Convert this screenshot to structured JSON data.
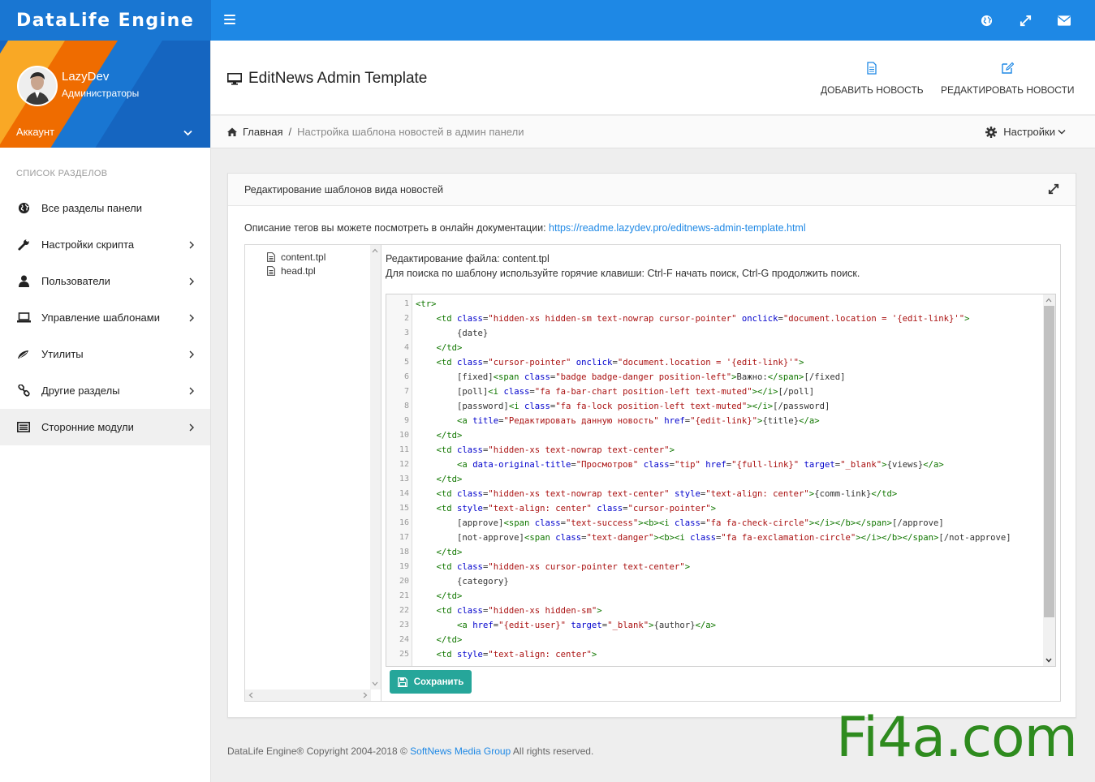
{
  "app": {
    "brand": "DataLife Engine"
  },
  "user": {
    "name": "LazyDev",
    "role": "Администраторы",
    "account_label": "Аккаунт"
  },
  "sidebar": {
    "section_title": "СПИСОК РАЗДЕЛОВ",
    "items": [
      {
        "label": "Все разделы панели",
        "icon": "globe-icon",
        "chevron": false
      },
      {
        "label": "Настройки скрипта",
        "icon": "wrench-icon",
        "chevron": true
      },
      {
        "label": "Пользователи",
        "icon": "user-icon",
        "chevron": true
      },
      {
        "label": "Управление шаблонами",
        "icon": "laptop-icon",
        "chevron": true
      },
      {
        "label": "Утилиты",
        "icon": "wand-icon",
        "chevron": true
      },
      {
        "label": "Другие разделы",
        "icon": "link-icon",
        "chevron": true
      },
      {
        "label": "Сторонние модули",
        "icon": "list-alt-icon",
        "chevron": true
      }
    ]
  },
  "header": {
    "title": "EditNews Admin Template",
    "add_news": "ДОБАВИТЬ НОВОСТЬ",
    "edit_news": "РЕДАКТИРОВАТЬ НОВОСТИ"
  },
  "breadcrumb": {
    "home": "Главная",
    "separator": "/",
    "current": "Настройка шаблона новостей в админ панели",
    "settings": "Настройки"
  },
  "panel": {
    "title": "Редактирование шаблонов вида новостей",
    "doc_text": "Описание тегов вы можете посмотреть в онлайн документации: ",
    "doc_link": "https://readme.lazydev.pro/editnews-admin-template.html"
  },
  "files": [
    "content.tpl",
    "head.tpl"
  ],
  "editor": {
    "file_label": "Редактирование файла: content.tpl",
    "hint": "Для поиска по шаблону используйте горячие клавиши: Ctrl-F начать поиск, Ctrl-G продолжить поиск.",
    "save_label": "Сохранить",
    "line_numbers": [
      "1",
      "2",
      "3",
      "4",
      "5",
      "6",
      "7",
      "8",
      "9",
      "10",
      "11",
      "12",
      "13",
      "14",
      "15",
      "16",
      "17",
      "18",
      "19",
      "20",
      "21",
      "22",
      "23",
      "24",
      "25"
    ],
    "lines": [
      "<tr>",
      "    <td class=\"hidden-xs hidden-sm text-nowrap cursor-pointer\" onclick=\"document.location = '{edit-link}'\">",
      "        {date}",
      "    </td>",
      "    <td class=\"cursor-pointer\" onclick=\"document.location = '{edit-link}'\">",
      "        [fixed]<span class=\"badge badge-danger position-left\">Важно:</span>[/fixed]",
      "        [poll]<i class=\"fa fa-bar-chart position-left text-muted\"></i>[/poll]",
      "        [password]<i class=\"fa fa-lock position-left text-muted\"></i>[/password]",
      "        <a title=\"Редактировать данную новость\" href=\"{edit-link}\">{title}</a>",
      "    </td>",
      "    <td class=\"hidden-xs text-nowrap text-center\">",
      "        <a data-original-title=\"Просмотров\" class=\"tip\" href=\"{full-link}\" target=\"_blank\">{views}</a>",
      "    </td>",
      "    <td class=\"hidden-xs text-nowrap text-center\" style=\"text-align: center\">{comm-link}</td>",
      "    <td style=\"text-align: center\" class=\"cursor-pointer\">",
      "        [approve]<span class=\"text-success\"><b><i class=\"fa fa-check-circle\"></i></b></span>[/approve]",
      "        [not-approve]<span class=\"text-danger\"><b><i class=\"fa fa-exclamation-circle\"></i></b></span>[/not-approve]",
      "    </td>",
      "    <td class=\"hidden-xs cursor-pointer text-center\">",
      "        {category}",
      "    </td>",
      "    <td class=\"hidden-xs hidden-sm\">",
      "        <a href=\"{edit-user}\" target=\"_blank\">{author}</a>",
      "    </td>",
      "    <td style=\"text-align: center\">"
    ]
  },
  "footer": {
    "prefix": "DataLife Engine® Copyright 2004-2018 © ",
    "link": "SoftNews Media Group",
    "suffix": " All rights reserved."
  },
  "watermark": "Fi4a.com"
}
